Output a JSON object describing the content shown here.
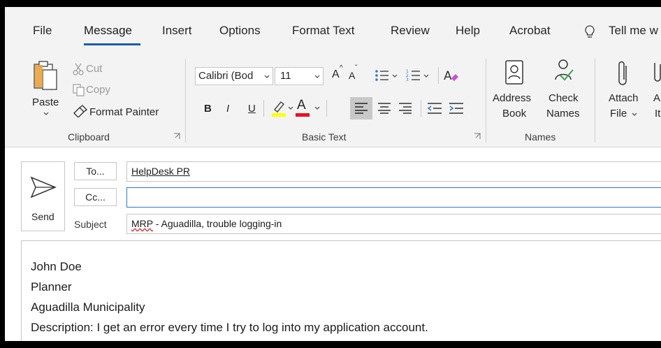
{
  "tabs": [
    "File",
    "Message",
    "Insert",
    "Options",
    "Format Text",
    "Review",
    "Help",
    "Acrobat",
    "Tell me w"
  ],
  "active_tab": "Message",
  "clipboard": {
    "paste": "Paste",
    "cut": "Cut",
    "copy": "Copy",
    "format_painter": "Format Painter",
    "group_label": "Clipboard"
  },
  "basic_text": {
    "font": "Calibri (Bod",
    "size": "11",
    "bold": "B",
    "italic": "I",
    "underline": "U",
    "grow": "A",
    "shrink": "A",
    "font_color": "A",
    "group_label": "Basic Text"
  },
  "names": {
    "address_book": [
      "Address",
      "Book"
    ],
    "check_names": [
      "Check",
      "Names"
    ],
    "group_label": "Names"
  },
  "include": {
    "attach_file": [
      "Attach",
      "File"
    ],
    "attach_item": [
      "A",
      "It"
    ]
  },
  "compose": {
    "send": "Send",
    "to_button": "To...",
    "cc_button": "Cc...",
    "subject_label": "Subject",
    "to_value": "HelpDesk PR",
    "cc_value": "",
    "subject_prefix": "MRP",
    "subject_rest": " - Aguadilla, trouble logging-in"
  },
  "body": {
    "lines": [
      "John Doe",
      "Planner",
      "Aguadilla Municipality",
      "Description: I get an error every time I try to log into my application account."
    ]
  },
  "colors": {
    "accent": "#1e5aa6",
    "highlight": "#ffff00",
    "font_color": "#e81123",
    "names_green": "#3da35a"
  }
}
